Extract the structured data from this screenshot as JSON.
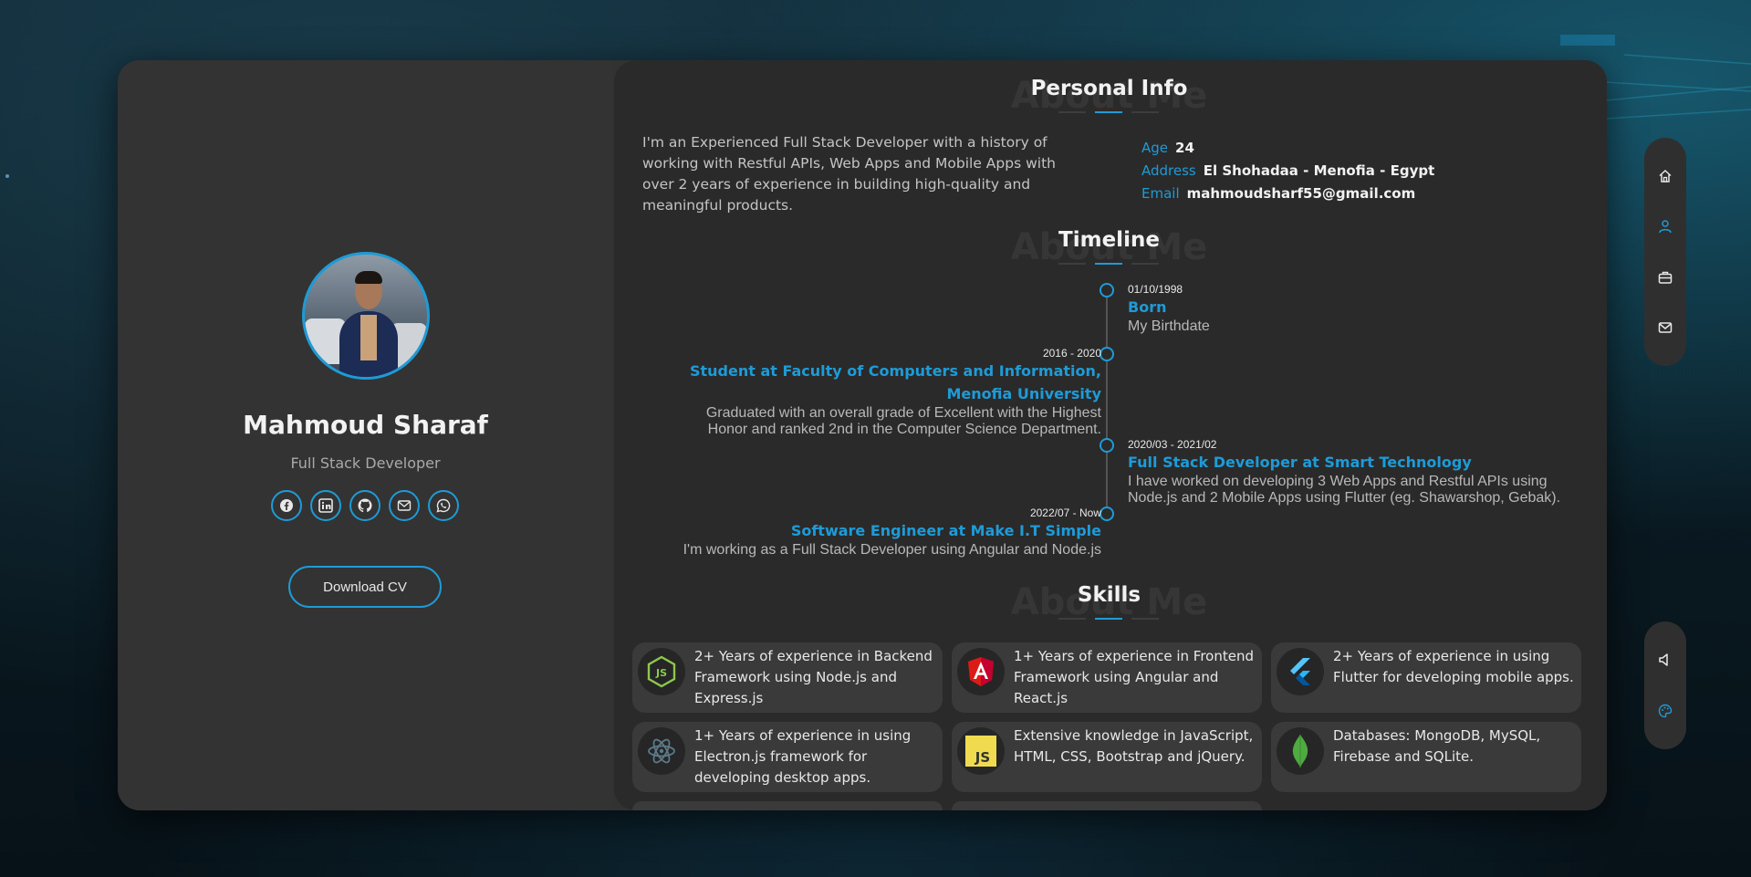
{
  "profile": {
    "name": "Mahmoud Sharaf",
    "role": "Full Stack Developer",
    "download_label": "Download CV",
    "socials": [
      "facebook",
      "linkedin",
      "github",
      "email",
      "whatsapp"
    ]
  },
  "personal_info": {
    "title": "Personal Info",
    "ghost": "About Me",
    "about": "I'm an Experienced Full Stack Developer with a history of working with Restful APIs, Web Apps and Mobile Apps with over 2 years of experience in building high-quality and meaningful products.",
    "age_label": "Age",
    "age": "24",
    "address_label": "Address",
    "address": "El Shohadaa - Menofia - Egypt",
    "email_label": "Email",
    "email": "mahmoudsharf55@gmail.com"
  },
  "timeline": {
    "title": "Timeline",
    "ghost": "About Me",
    "items": [
      {
        "date": "01/10/1998",
        "title": "Born",
        "desc": "My Birthdate"
      },
      {
        "date": "2016 - 2020",
        "title": "Student at Faculty of Computers and Information, Menofia University",
        "desc": "Graduated with an overall grade of Excellent with the Highest Honor and ranked 2nd in the Computer Science Department."
      },
      {
        "date": "2020/03 - 2021/02",
        "title": "Full Stack Developer at Smart Technology",
        "desc": "I have worked on developing 3 Web Apps and Restful APIs using Node.js and 2 Mobile Apps using Flutter (eg. Shawarshop, Gebak)."
      },
      {
        "date": "2022/07 - Now",
        "title": "Software Engineer at Make I.T Simple",
        "desc": "I'm working as a Full Stack Developer using Angular and Node.js"
      }
    ]
  },
  "skills": {
    "title": "Skills",
    "ghost": "About Me",
    "items": [
      {
        "icon": "nodejs-icon",
        "text": "2+ Years of experience in Backend Framework using Node.js and Express.js"
      },
      {
        "icon": "angular-icon",
        "text": "1+ Years of experience in Frontend Framework using Angular and React.js"
      },
      {
        "icon": "flutter-icon",
        "text": "2+ Years of experience in using Flutter for developing mobile apps."
      },
      {
        "icon": "electron-icon",
        "text": "1+ Years of experience in using Electron.js framework for developing desktop apps."
      },
      {
        "icon": "javascript-icon",
        "text": "Extensive knowledge in JavaScript, HTML, CSS, Bootstrap and jQuery."
      },
      {
        "icon": "mongodb-icon",
        "text": "Databases: MongoDB, MySQL, Firebase and SQLite."
      }
    ]
  },
  "nav": [
    "home-icon",
    "user-icon",
    "briefcase-icon",
    "mail-icon"
  ],
  "tools": [
    "volume-icon",
    "palette-icon"
  ],
  "colors": {
    "accent": "#1e9bd7",
    "card": "#323232",
    "panel": "#2a2a2a"
  }
}
